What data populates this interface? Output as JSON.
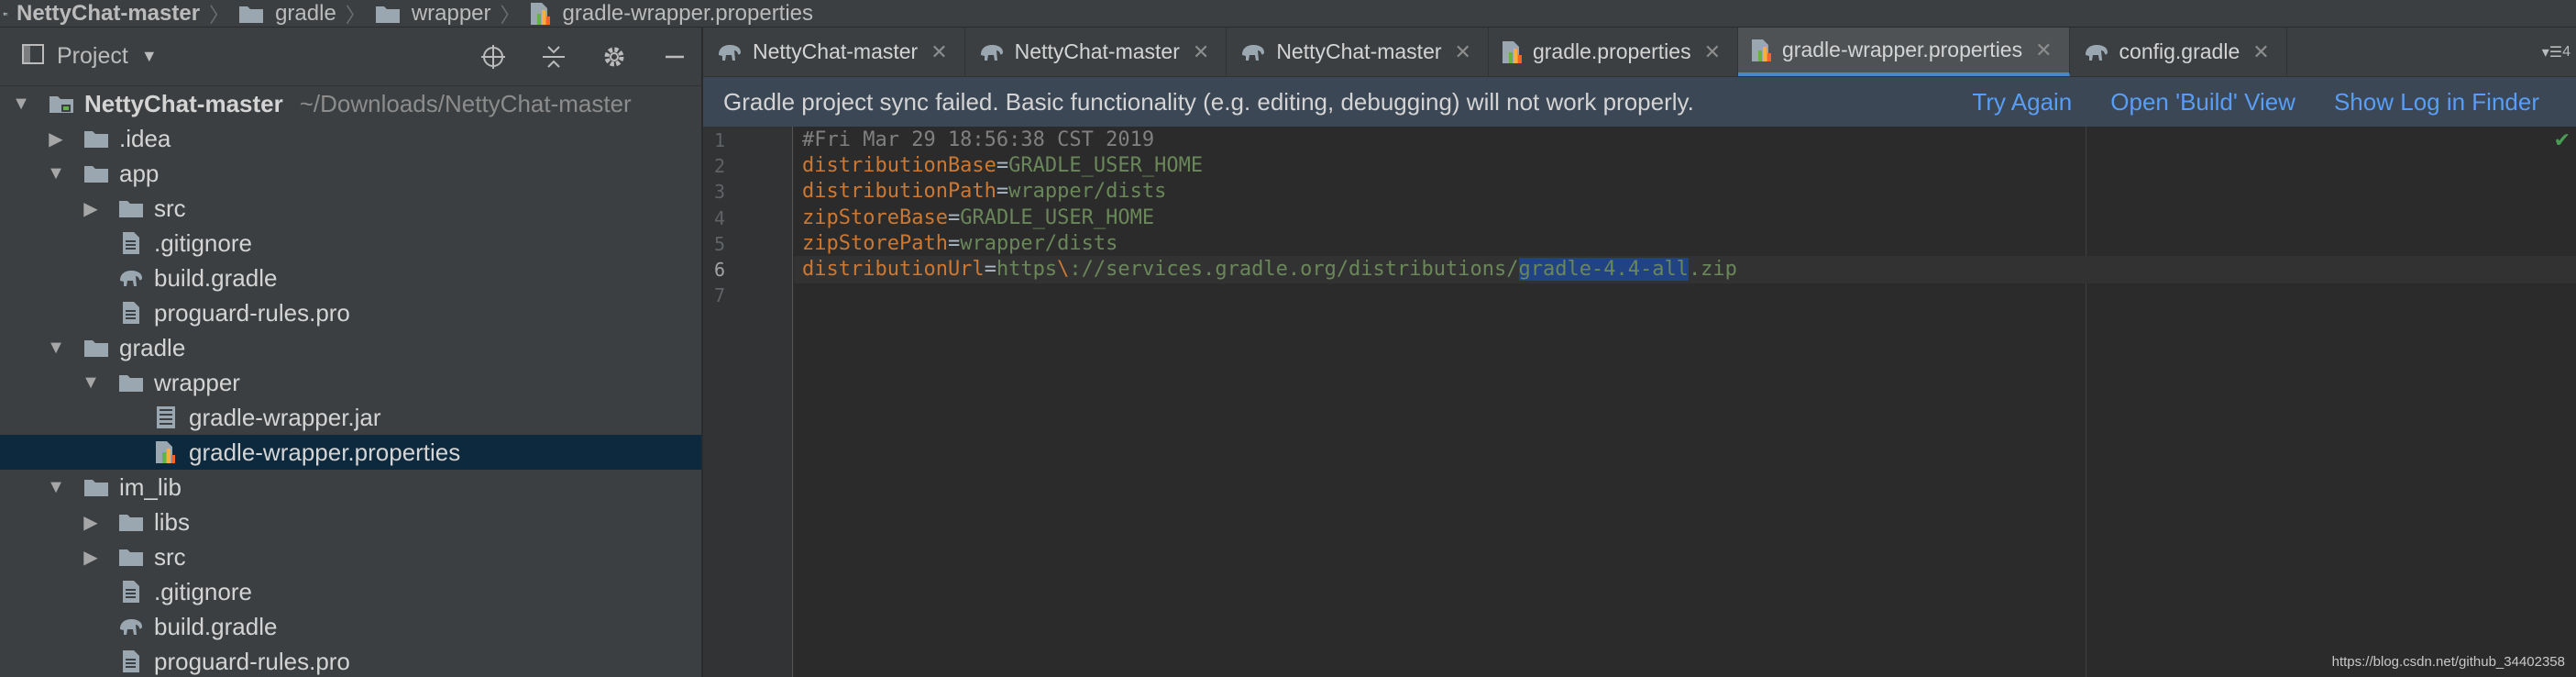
{
  "breadcrumb": [
    {
      "label": "NettyChat-master",
      "icon": "project-folder-icon"
    },
    {
      "label": "gradle",
      "icon": "folder-icon"
    },
    {
      "label": "wrapper",
      "icon": "folder-icon"
    },
    {
      "label": "gradle-wrapper.properties",
      "icon": "properties-file-icon"
    }
  ],
  "project_panel": {
    "title": "Project",
    "tree": [
      {
        "label": "NettyChat-master",
        "path": "~/Downloads/NettyChat-master",
        "arrow": "expanded",
        "icon": "project-folder-icon",
        "level": 0,
        "root": true
      },
      {
        "label": ".idea",
        "arrow": "collapsed",
        "icon": "folder-icon",
        "level": 1
      },
      {
        "label": "app",
        "arrow": "expanded",
        "icon": "folder-icon",
        "level": 1
      },
      {
        "label": "src",
        "arrow": "collapsed",
        "icon": "folder-icon",
        "level": 2
      },
      {
        "label": ".gitignore",
        "arrow": "none",
        "icon": "text-file-icon",
        "level": 2
      },
      {
        "label": "build.gradle",
        "arrow": "none",
        "icon": "gradle-elephant-icon",
        "level": 2
      },
      {
        "label": "proguard-rules.pro",
        "arrow": "none",
        "icon": "text-file-icon",
        "level": 2
      },
      {
        "label": "gradle",
        "arrow": "expanded",
        "icon": "folder-icon",
        "level": 1
      },
      {
        "label": "wrapper",
        "arrow": "expanded",
        "icon": "folder-icon",
        "level": 2
      },
      {
        "label": "gradle-wrapper.jar",
        "arrow": "none",
        "icon": "jar-file-icon",
        "level": 3
      },
      {
        "label": "gradle-wrapper.properties",
        "arrow": "none",
        "icon": "properties-file-icon",
        "level": 3,
        "selected": true
      },
      {
        "label": "im_lib",
        "arrow": "expanded",
        "icon": "folder-icon",
        "level": 1
      },
      {
        "label": "libs",
        "arrow": "collapsed",
        "icon": "folder-icon",
        "level": 2
      },
      {
        "label": "src",
        "arrow": "collapsed",
        "icon": "folder-icon",
        "level": 2
      },
      {
        "label": ".gitignore",
        "arrow": "none",
        "icon": "text-file-icon",
        "level": 2
      },
      {
        "label": "build.gradle",
        "arrow": "none",
        "icon": "gradle-elephant-icon",
        "level": 2
      },
      {
        "label": "proguard-rules.pro",
        "arrow": "none",
        "icon": "text-file-icon",
        "level": 2
      }
    ]
  },
  "tabs": [
    {
      "label": "NettyChat-master",
      "icon": "gradle-elephant-icon",
      "active": false
    },
    {
      "label": "NettyChat-master",
      "icon": "gradle-elephant-icon",
      "active": false
    },
    {
      "label": "NettyChat-master",
      "icon": "gradle-elephant-icon",
      "active": false
    },
    {
      "label": "gradle.properties",
      "icon": "properties-file-icon",
      "active": false
    },
    {
      "label": "gradle-wrapper.properties",
      "icon": "properties-file-icon",
      "active": true
    },
    {
      "label": "config.gradle",
      "icon": "gradle-elephant-icon",
      "active": false
    }
  ],
  "tabs_overflow": "4",
  "banner": {
    "message": "Gradle project sync failed. Basic functionality (e.g. editing, debugging) will not work properly.",
    "try_again": "Try Again",
    "open_build_view": "Open 'Build' View",
    "show_log": "Show Log in Finder"
  },
  "editor": {
    "current_line": 6,
    "lines": [
      {
        "n": "1",
        "comment": "#Fri Mar 29 18:56:38 CST 2019"
      },
      {
        "n": "2",
        "key": "distributionBase",
        "value": "GRADLE_USER_HOME"
      },
      {
        "n": "3",
        "key": "distributionPath",
        "value": "wrapper/dists"
      },
      {
        "n": "4",
        "key": "zipStoreBase",
        "value": "GRADLE_USER_HOME"
      },
      {
        "n": "5",
        "key": "zipStorePath",
        "value": "wrapper/dists"
      },
      {
        "n": "6",
        "key": "distributionUrl",
        "value_pre": "https\\://services.gradle.org/distributions/",
        "value_sel": "gradle-4.4-all",
        "value_post": ".zip"
      },
      {
        "n": "7"
      }
    ]
  },
  "watermark": "https://blog.csdn.net/github_34402358",
  "colors": {
    "accent": "#4a88c7",
    "link": "#589df6",
    "keyword": "#cc7832",
    "string": "#6a8759",
    "selection": "#214283"
  }
}
